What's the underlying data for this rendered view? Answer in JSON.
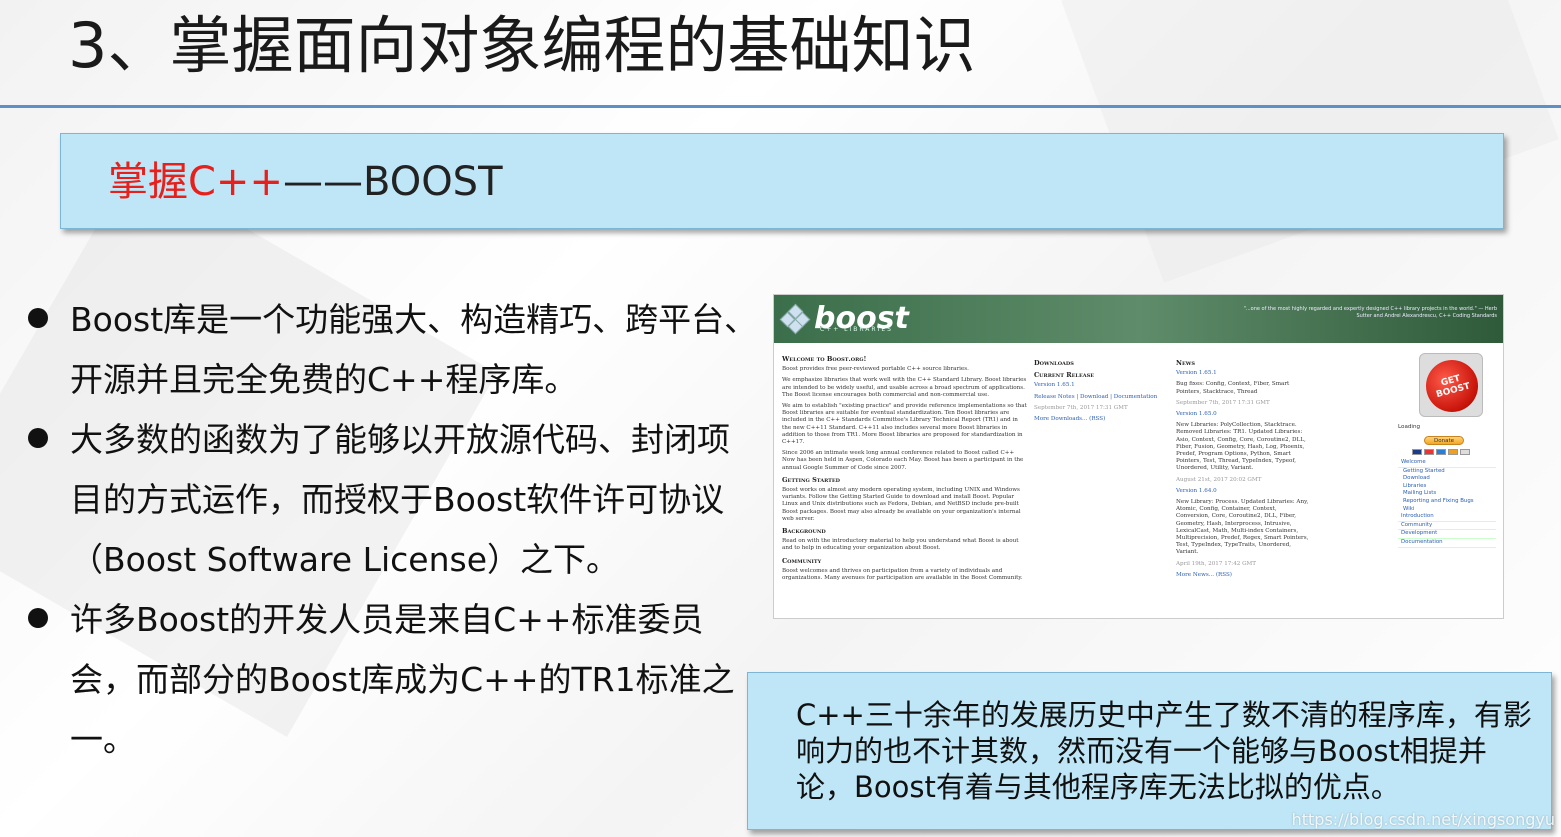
{
  "slide": {
    "title": "3、掌握面向对象编程的基础知识",
    "topic_red": "掌握C++",
    "topic_dark": "——BOOST",
    "bullets": [
      "Boost库是一个功能强大、构造精巧、跨平台、开源并且完全免费的C++程序库。",
      "大多数的函数为了能够以开放源代码、封闭项目的方式运作，而授权于Boost软件许可协议（Boost Software License）之下。",
      "许多Boost的开发人员是来自C++标准委员会，而部分的Boost库成为C++的TR1标准之一。"
    ],
    "info_box": "C++三十余年的发展历史中产生了数不清的程序库，有影响力的也不计其数，然而没有一个能够与Boost相提并论，Boost有着与其他程序库无法比拟的优点。",
    "watermark": "https://blog.csdn.net/xingsongyu"
  },
  "boost_site": {
    "logo": "boost",
    "logo_sub": "C++ LIBRARIES",
    "quote": "\"...one of the most highly regarded and expertly designed C++ library projects in the world.\" — Herb Sutter and Andrei Alexandrescu, C++ Coding Standards",
    "welcome_title": "Welcome to Boost.org!",
    "welcome_p1": "Boost provides free peer-reviewed portable C++ source libraries.",
    "welcome_p2": "We emphasize libraries that work well with the C++ Standard Library. Boost libraries are intended to be widely useful, and usable across a broad spectrum of applications. The Boost license encourages both commercial and non-commercial use.",
    "welcome_p3": "We aim to establish \"existing practice\" and provide reference implementations so that Boost libraries are suitable for eventual standardization. Ten Boost libraries are included in the C++ Standards Committee's Library Technical Report (TR1) and in the new C++11 Standard. C++11 also includes several more Boost libraries in addition to those from TR1. More Boost libraries are proposed for standardization in C++17.",
    "welcome_p4": "Since 2006 an intimate week long annual conference related to Boost called C++ Now has been held in Aspen, Colorado each May. Boost has been a participant in the annual Google Summer of Code since 2007.",
    "getting_started_title": "Getting Started",
    "getting_started_p": "Boost works on almost any modern operating system, including UNIX and Windows variants. Follow the Getting Started Guide to download and install Boost. Popular Linux and Unix distributions such as Fedora, Debian, and NetBSD include pre-built Boost packages. Boost may also already be available on your organization's internal web server.",
    "background_title": "Background",
    "background_p": "Read on with the introductory material to help you understand what Boost is about and to help in educating your organization about Boost.",
    "community_title": "Community",
    "community_p": "Boost welcomes and thrives on participation from a variety of individuals and organizations. Many avenues for participation are available in the Boost Community.",
    "downloads_title": "Downloads",
    "current_release_title": "Current Release",
    "current_version": "Version 1.65.1",
    "current_links": "Release Notes | Download | Documentation",
    "current_date": "September 7th, 2017 17:31 GMT",
    "more_downloads": "More Downloads... (RSS)",
    "news_title": "News",
    "news": [
      {
        "version": "Version 1.65.1",
        "text": "Bug fixes: Config, Context, Fiber, Smart Pointers, Stacktrace, Thread",
        "date": "September 7th, 2017 17:31 GMT"
      },
      {
        "version": "Version 1.65.0",
        "text": "New Libraries: PolyCollection, Stacktrace. Removed Libraries: TR1. Updated Libraries: Asio, Context, Config, Core, Coroutine2, DLL, Fiber, Fusion, Geometry, Hash, Log, Phoenix, Predef, Program Options, Python, Smart Pointers, Test, Thread, TypeIndex, Typeof, Unordered, Utility, Variant.",
        "date": "August 21st, 2017 20:02 GMT"
      },
      {
        "version": "Version 1.64.0",
        "text": "New Library: Process. Updated Libraries: Any, Atomic, Config, Container, Context, Conversion, Core, Coroutine2, DLL, Fiber, Geometry, Hash, Interprocess, Intrusive, LexicalCast, Math, Multi-index Containers, Multiprecision, Predef, Regex, Smart Pointers, Test, TypeIndex, TypeTraits, Unordered, Variant.",
        "date": "April 19th, 2017 17:42 GMT"
      }
    ],
    "more_news": "More News... (RSS)",
    "get_boost": "GET BOOST",
    "loading": "Loading",
    "donate": "Donate",
    "nav": {
      "welcome": "Welcome",
      "sub": [
        "Getting Started",
        "Download",
        "Libraries",
        "Mailing Lists",
        "Reporting and Fixing Bugs",
        "Wiki"
      ],
      "sections": [
        "Introduction",
        "Community",
        "Development",
        "Documentation"
      ]
    }
  },
  "colors": {
    "accent_blue_box": "#bfe6f7",
    "title_rule": "#5d90c4",
    "topic_red": "#e8201c",
    "boost_header_green": "#3b6e4a"
  }
}
